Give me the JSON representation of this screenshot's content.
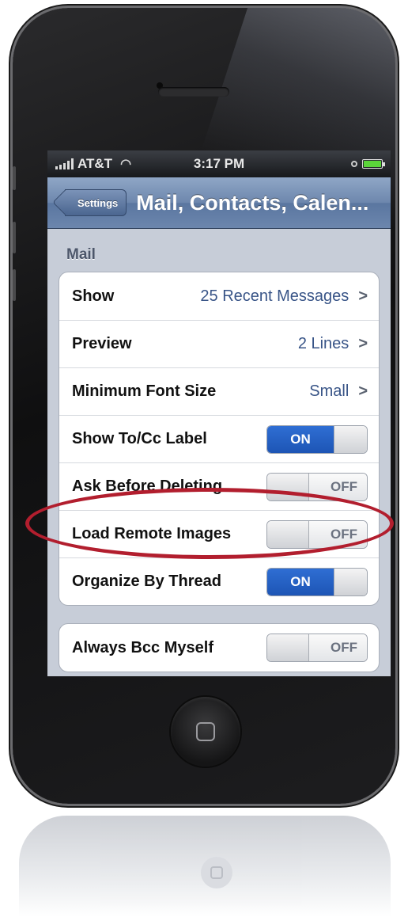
{
  "status_bar": {
    "carrier": "AT&T",
    "time": "3:17 PM"
  },
  "nav_bar": {
    "back_label": "Settings",
    "title": "Mail, Contacts, Calen..."
  },
  "mail_section": {
    "header": "Mail",
    "rows": [
      {
        "label": "Show",
        "value": "25 Recent Messages"
      },
      {
        "label": "Preview",
        "value": "2 Lines"
      },
      {
        "label": "Minimum Font Size",
        "value": "Small"
      },
      {
        "label": "Show To/Cc Label",
        "toggle": "ON"
      },
      {
        "label": "Ask Before Deleting",
        "toggle": "OFF"
      },
      {
        "label": "Load Remote Images",
        "toggle": "OFF"
      },
      {
        "label": "Organize By Thread",
        "toggle": "ON"
      }
    ]
  },
  "second_group": {
    "rows": [
      {
        "label": "Always Bcc Myself",
        "toggle": "OFF"
      }
    ]
  },
  "colors": {
    "toggle_on": "#1d55b5",
    "annotation_ellipse": "#b21e2e",
    "navbar": "#6d87ad"
  }
}
